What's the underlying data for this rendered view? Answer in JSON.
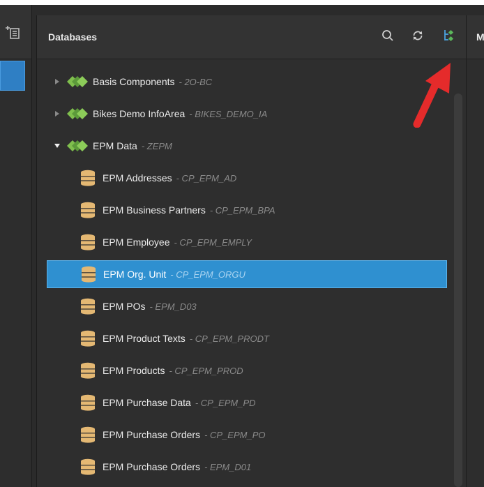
{
  "colors": {
    "background": "#2b2b2b",
    "selection": "#2f90d0",
    "infoarea_icon": "#6fae48",
    "database_icon": "#e4b873",
    "annotation_arrow": "#e52b2b",
    "toolbar_highlight_icon": "#5cb85c"
  },
  "panel": {
    "title": "Databases",
    "icons": [
      "search-icon",
      "refresh-icon",
      "tree-view-icon"
    ]
  },
  "right_panel": {
    "letter": "M"
  },
  "tree": {
    "items": [
      {
        "label": "Basis Components",
        "tech": "- 2O-BC",
        "kind": "infoarea",
        "twisty": "collapsed",
        "selected": false
      },
      {
        "label": "Bikes Demo InfoArea",
        "tech": "- BIKES_DEMO_IA",
        "kind": "infoarea",
        "twisty": "collapsed",
        "selected": false
      },
      {
        "label": "EPM Data",
        "tech": "- ZEPM",
        "kind": "infoarea",
        "twisty": "expanded",
        "selected": false
      },
      {
        "label": "EPM Addresses",
        "tech": "- CP_EPM_AD",
        "kind": "database",
        "selected": false
      },
      {
        "label": "EPM Business Partners",
        "tech": "- CP_EPM_BPA",
        "kind": "database",
        "selected": false
      },
      {
        "label": "EPM Employee",
        "tech": "- CP_EPM_EMPLY",
        "kind": "database",
        "selected": false
      },
      {
        "label": "EPM Org. Unit",
        "tech": "- CP_EPM_ORGU",
        "kind": "database",
        "selected": true
      },
      {
        "label": "EPM POs",
        "tech": "- EPM_D03",
        "kind": "database",
        "selected": false
      },
      {
        "label": "EPM Product Texts",
        "tech": "- CP_EPM_PRODT",
        "kind": "database",
        "selected": false
      },
      {
        "label": "EPM Products",
        "tech": "- CP_EPM_PROD",
        "kind": "database",
        "selected": false
      },
      {
        "label": "EPM Purchase Data",
        "tech": "- CP_EPM_PD",
        "kind": "database",
        "selected": false
      },
      {
        "label": "EPM Purchase Orders",
        "tech": "- CP_EPM_PO",
        "kind": "database",
        "selected": false
      },
      {
        "label": "EPM Purchase Orders",
        "tech": "- EPM_D01",
        "kind": "database",
        "selected": false
      }
    ]
  }
}
